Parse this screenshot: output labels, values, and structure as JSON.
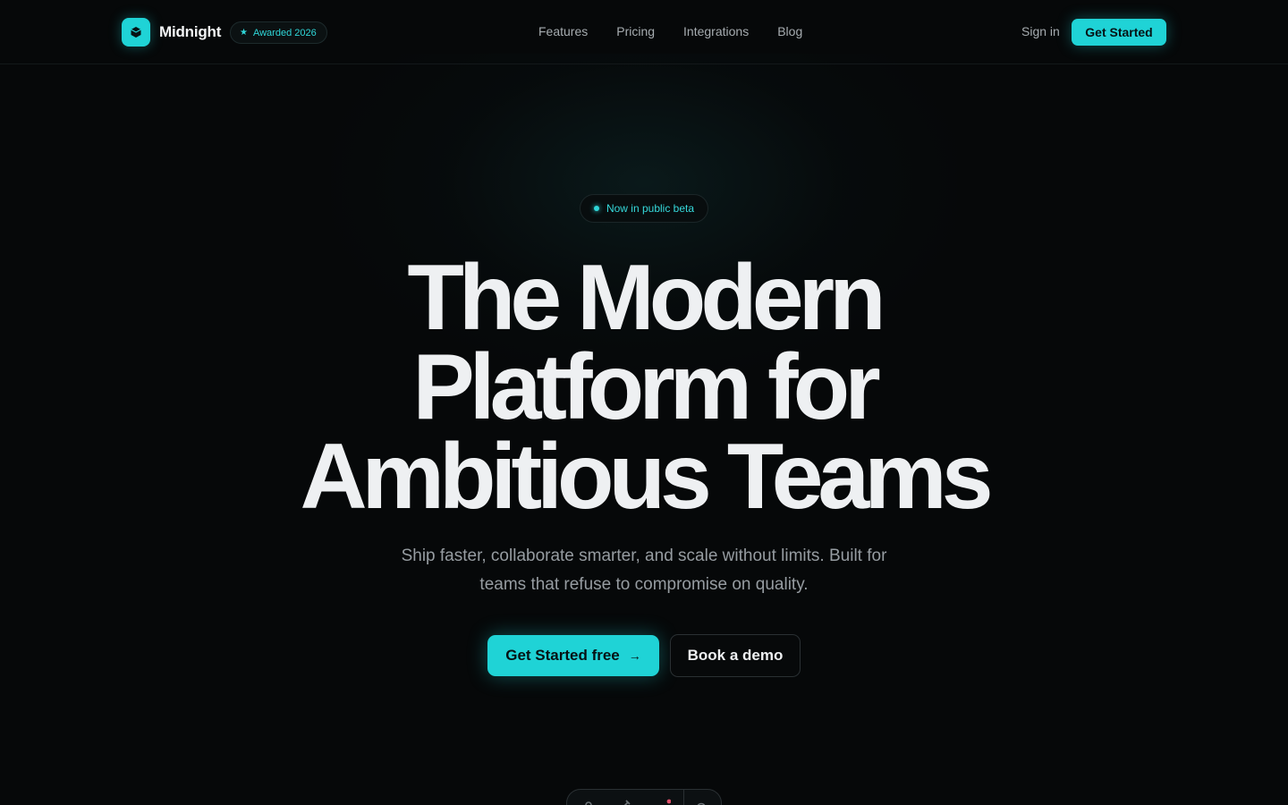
{
  "brand": {
    "name": "Midnight",
    "award": "Awarded 2026",
    "award_icon": "star-icon",
    "logo_icon": "cube-icon"
  },
  "nav": {
    "items": [
      "Features",
      "Pricing",
      "Integrations",
      "Blog"
    ]
  },
  "header_actions": {
    "signin": "Sign in",
    "cta": "Get Started"
  },
  "hero": {
    "badge": "Now in public beta",
    "title_lines": [
      "The Modern",
      "Platform for",
      "Ambitious Teams"
    ],
    "subtitle_line1": "Ship faster, collaborate smarter, and scale without limits. Built for",
    "subtitle_line2": "teams that refuse to compromise on quality.",
    "primary_cta": "Get Started free",
    "primary_cta_icon": "arrow-right-icon",
    "secondary_cta": "Book a demo"
  },
  "dock": {
    "icons": [
      "person-icon",
      "brush-icon",
      "menu-icon",
      "settings-icon"
    ]
  },
  "colors": {
    "accent": "#1fd3d6",
    "background": "#060809",
    "text": "#eef0f2",
    "muted": "#969ca1"
  }
}
